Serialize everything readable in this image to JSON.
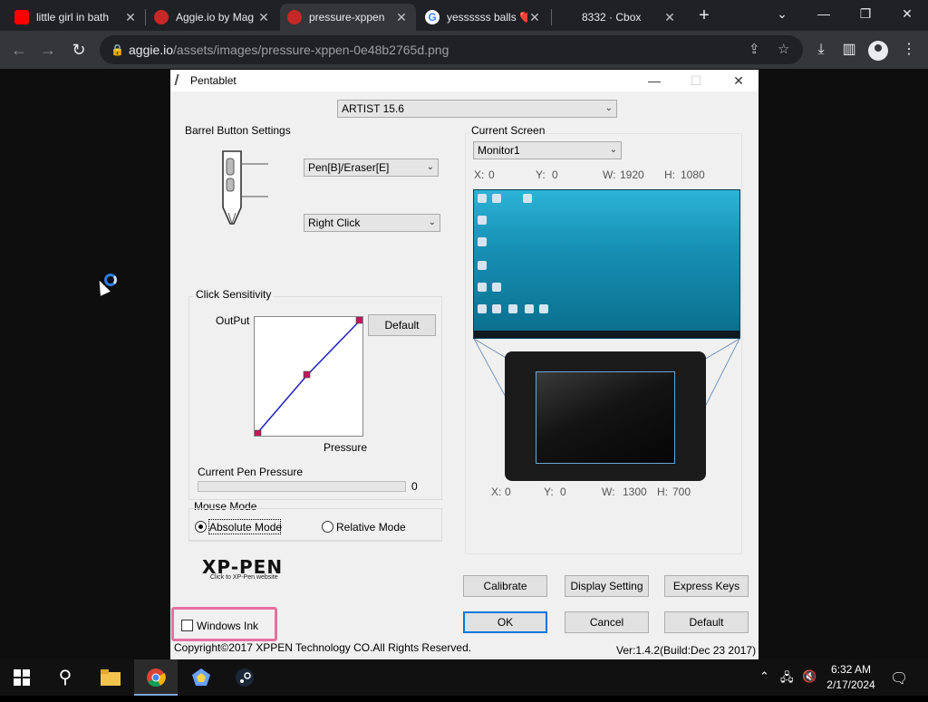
{
  "browser": {
    "tabs": [
      {
        "title": "little girl in bath",
        "favicon": "youtube-icon",
        "color": "#ff0000"
      },
      {
        "title": "Aggie.io by Mag",
        "favicon": "aggie-icon",
        "color": "#c62828"
      },
      {
        "title": "pressure-xppen",
        "favicon": "aggie-icon",
        "color": "#c62828",
        "active": true
      },
      {
        "title": "yessssss balls ❤️",
        "favicon": "google-icon",
        "color": "#4285f4"
      },
      {
        "title": "8332 · Cbox",
        "favicon": "",
        "color": ""
      }
    ],
    "url_host": "aggie.io",
    "url_path": "/assets/images/pressure-xppen-0e48b2765d.png"
  },
  "app": {
    "title": "Pentablet",
    "device_select": "ARTIST 15.6",
    "barrel": {
      "heading": "Barrel Button Settings",
      "button1": "Pen[B]/Eraser[E]",
      "button2": "Right Click"
    },
    "sensitivity": {
      "heading": "Click Sensitivity",
      "output_label": "OutPut",
      "pressure_label": "Pressure",
      "default_button": "Default"
    },
    "current_pressure": {
      "label": "Current Pen Pressure",
      "value": "0",
      "level": 0
    },
    "mouse_mode": {
      "heading": "Mouse Mode",
      "absolute": "Absolute Mode",
      "relative": "Relative Mode",
      "selected": "absolute"
    },
    "logo": {
      "text": "XP-PEN",
      "subtext": "Click to XP-Pen website"
    },
    "windows_ink": {
      "label": "Windows Ink",
      "checked": false
    },
    "copyright": "Copyright©2017 XPPEN Technology CO.All Rights Reserved.",
    "version": "Ver:1.4.2(Build:Dec 23 2017)",
    "screen": {
      "heading": "Current Screen",
      "monitor_select": "Monitor1",
      "x_label": "X:",
      "x_value": "0",
      "y_label": "Y:",
      "y_value": "0",
      "w_label": "W:",
      "w_value": "1920",
      "h_label": "H:",
      "h_value": "1080"
    },
    "tablet_area": {
      "x_label": "X:",
      "x_value": "0",
      "y_label": "Y:",
      "y_value": "0",
      "w_label": "W:",
      "w_value": "1300",
      "h_label": "H:",
      "h_value": "700"
    },
    "buttons": {
      "calibrate": "Calibrate",
      "display_setting": "Display Setting",
      "express_keys": "Express Keys",
      "ok": "OK",
      "cancel": "Cancel",
      "default": "Default"
    },
    "highlight_color": "#e86fa0"
  },
  "taskbar": {
    "time": "6:32 AM",
    "date": "2/17/2024",
    "apps": [
      "start-icon",
      "search-icon",
      "file-explorer-icon",
      "chrome-icon",
      "app-icon",
      "steam-icon"
    ]
  }
}
